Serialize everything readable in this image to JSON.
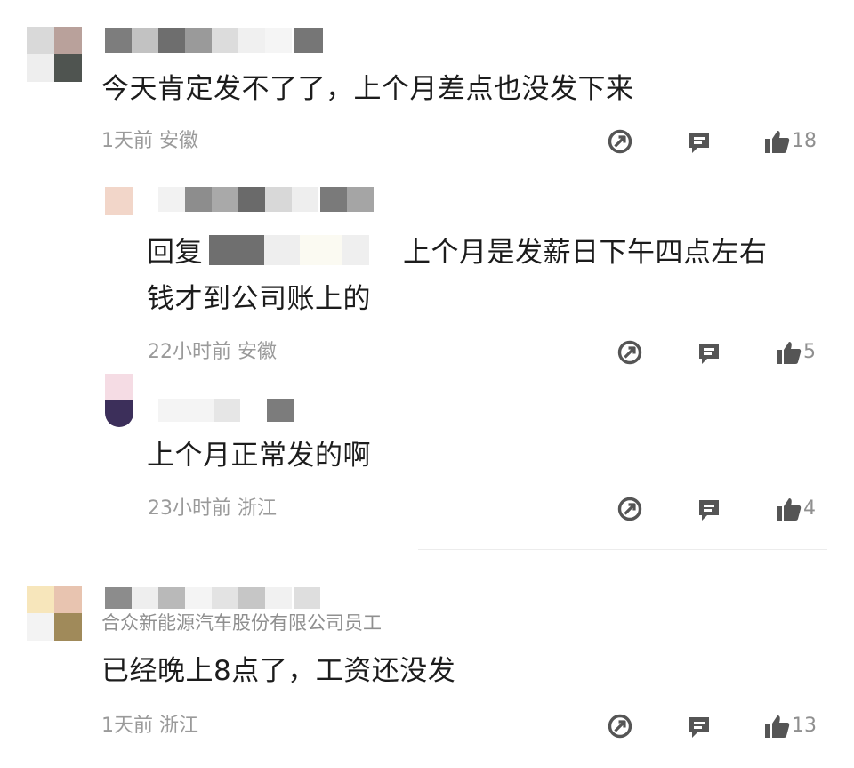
{
  "comments": [
    {
      "text": "今天肯定发不了了，上个月差点也没发下来",
      "time_location": "1天前 安徽",
      "likes": "18"
    },
    {
      "reply_prefix": "回复",
      "text_line1": "上个月是发薪日下午四点左右",
      "text_line2": "钱才到公司账上的",
      "time_location": "22小时前 安徽",
      "likes": "5"
    },
    {
      "text": "上个月正常发的啊",
      "time_location": "23小时前 浙江",
      "likes": "4"
    },
    {
      "badge": "合众新能源汽车股份有限公司员工",
      "text": "已经晚上8点了，工资还没发",
      "time_location": "1天前 浙江",
      "likes": "13"
    }
  ],
  "icons": {
    "share": "share-icon",
    "reply": "comment-icon",
    "like": "thumbs-up-icon"
  },
  "colors": {
    "icon": "#555555",
    "meta_text": "#9a9a9a",
    "body_text": "#1c1c1c"
  }
}
